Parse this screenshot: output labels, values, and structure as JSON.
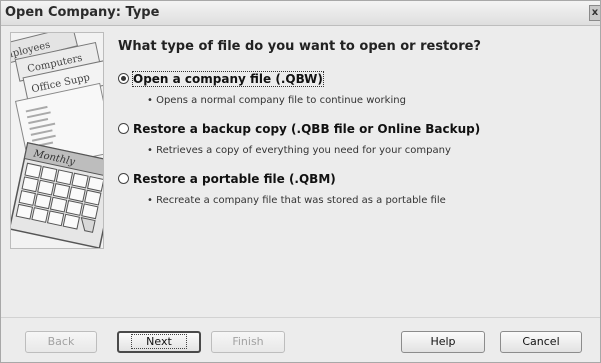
{
  "window": {
    "title": "Open Company: Type",
    "close_glyph": "x"
  },
  "illustration": {
    "labels": {
      "employees": "mployees",
      "computers": "Computers",
      "office": "Office Supp",
      "monthly": "Monthly"
    }
  },
  "dialog": {
    "question": "What type of file do you want to open or restore?",
    "options": [
      {
        "label": "Open a company file (.QBW)",
        "description": "• Opens a normal company file to continue working",
        "selected": true
      },
      {
        "label": "Restore a backup copy (.QBB file or Online Backup)",
        "description": "• Retrieves a copy of everything you need for your company",
        "selected": false
      },
      {
        "label": "Restore a portable file (.QBM)",
        "description": "• Recreate a company file that was stored as a portable file",
        "selected": false
      }
    ]
  },
  "buttons": {
    "back": "Back",
    "next": "Next",
    "finish": "Finish",
    "help": "Help",
    "cancel": "Cancel"
  }
}
